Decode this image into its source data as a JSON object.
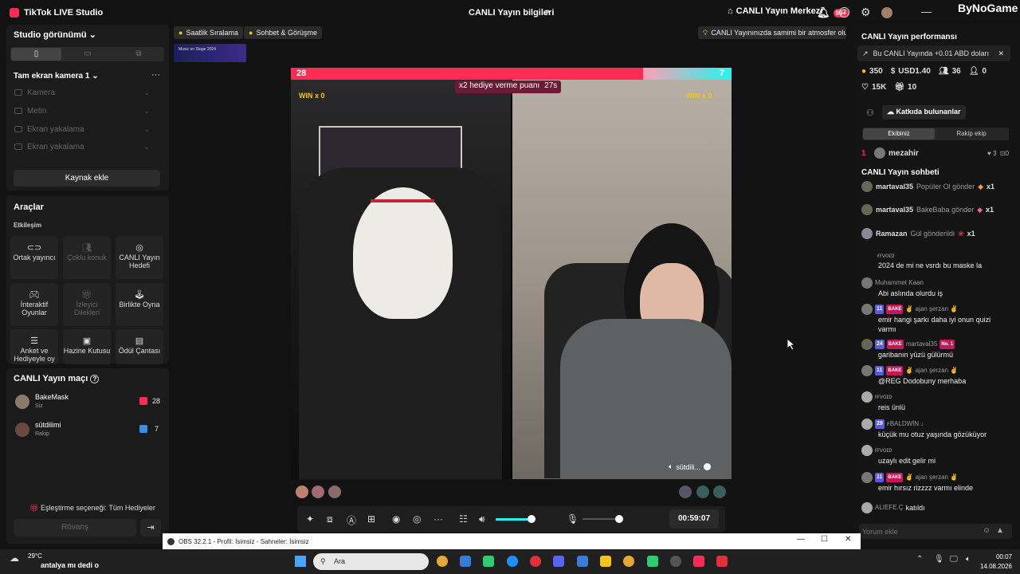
{
  "window": {
    "title": "TikTok LIVE Studio",
    "center_title": "CANLI Yayın bilgileri",
    "live_center": "CANLI Yayın Merkezi",
    "notif_count": "99+",
    "watermark": "ByNoGame"
  },
  "left": {
    "studio_view": "Studio görünümü",
    "scene_name": "Tam ekran kamera 1",
    "sources": [
      "Kamera",
      "Metin",
      "Ekran yakalama",
      "Ekran yakalama"
    ],
    "add_source": "Kaynak ekle",
    "tools_title": "Araçlar",
    "tools_section": "Etkileşim",
    "tools": [
      {
        "label": "Ortak yayıncı",
        "icon": "link-icon",
        "enabled": true
      },
      {
        "label": "Çoklu konuk",
        "icon": "users-icon",
        "enabled": false
      },
      {
        "label": "CANLI Yayın Hedefi",
        "icon": "target-icon",
        "enabled": true
      },
      {
        "label": "İnteraktif Oyunlar",
        "icon": "gamepad-icon",
        "enabled": true
      },
      {
        "label": "İzleyici Dilekleri",
        "icon": "gift-icon",
        "enabled": false
      },
      {
        "label": "Birlikte Oyna",
        "icon": "joystick-icon",
        "enabled": true
      },
      {
        "label": "Anket ve Hediyeyle oy",
        "icon": "poll-icon",
        "enabled": true
      },
      {
        "label": "Hazine Kutusu",
        "icon": "chest-icon",
        "enabled": true
      },
      {
        "label": "Ödül Çantası",
        "icon": "bag-icon",
        "enabled": true
      }
    ],
    "match_title": "CANLI Yayın maçı",
    "match": [
      {
        "name": "BakeMask",
        "role": "Siz",
        "score": "28"
      },
      {
        "name": "sütdilimi",
        "role": "Rakip",
        "score": "7"
      }
    ],
    "match_option": "Eşleştirme seçeneği: Tüm Hediyeler",
    "rematch": "Rövanş"
  },
  "center": {
    "pill1": "Saatlik Sıralama",
    "pill2": "Sohbet & Görüşme",
    "tip": "CANLI Yayınınızda samimi bir atmosfer olu...",
    "score_left": "28",
    "score_right": "7",
    "win_left": "WIN x 0",
    "win_right": "WIN x 0",
    "bonus_text": "x2 hediye verme puanı",
    "bonus_time": "27s",
    "opponent_label": "sütdili...",
    "timer": "00:59:07",
    "banner_text": "Music on Stage 2024"
  },
  "right": {
    "perf_title": "CANLI Yayın performansı",
    "earning": "Bu CANLI Yayında +0.01 ABD doları",
    "stats": {
      "coins": "350",
      "usd": "USD1.40",
      "users": "36",
      "viewers_now": "0",
      "likes": "15K",
      "gifts": "10"
    },
    "contributors": "Katkıda bulunanlar",
    "tab_team": "Ekibiniz",
    "tab_rival": "Rakip ekip",
    "top_rank": "1",
    "top_user": "mezahir",
    "top_likes": "3",
    "top_gifts": "0",
    "chat_title": "CANLI Yayın sohbeti",
    "gifts": [
      {
        "user": "martaval35",
        "text": "Popüler Ol gönder",
        "count": "x1"
      },
      {
        "user": "martaval35",
        "text": "BakeBaba gönder",
        "count": "x1"
      },
      {
        "user": "Ramazan",
        "text": "Gül gönderildi",
        "count": "x1"
      }
    ],
    "chat": [
      {
        "user": "ғғᴠᴏɪᴅ",
        "level": "",
        "text": "2024 de mi ne vsrdı bu maske la"
      },
      {
        "user": "Muhammet Kaan",
        "level": "",
        "text": "Abi aslında olurdu iş"
      },
      {
        "user": "✌ ajan şerzan ✌",
        "level": "11",
        "text": "emir hangi şarkı daha iyi onun quizi varmı"
      },
      {
        "user": "martaval35",
        "level": "24",
        "text": "garibanın yüzü gülürmü"
      },
      {
        "user": "✌ ajan şerzan ✌",
        "level": "11",
        "text": "@REG Dodobuny merhaba"
      },
      {
        "user": "ғғᴠᴏɪᴅ",
        "level": "",
        "text": "reis ünlü"
      },
      {
        "user": "ꜰBALDWİN ♩",
        "level": "29",
        "text": "küçük mu otuz yaşında gözüküyor"
      },
      {
        "user": "ғғᴠᴏɪᴅ",
        "level": "",
        "text": "uzaylı edit gelir mi"
      },
      {
        "user": "✌ ajan şerzan ✌",
        "level": "11",
        "text": "emir hırsız rizzzz varmı elinde"
      },
      {
        "user": "ALIEFE.Ç",
        "level": "",
        "text": "katıldı"
      }
    ],
    "comment_placeholder": "Yorum ekle"
  },
  "obs": {
    "title": "OBS 32.2.1 - Profil: İsimsiz - Sahneler: İsimsiz"
  },
  "taskbar": {
    "weather": "29°C",
    "news": "antalya mı dedi o",
    "search": "Ara",
    "time": "00:07",
    "date": "14.08.2026"
  },
  "colors": {
    "accent": "#fe2c55",
    "cyan": "#25f4ee",
    "bg": "#121212",
    "panel": "#1b1b1b"
  }
}
